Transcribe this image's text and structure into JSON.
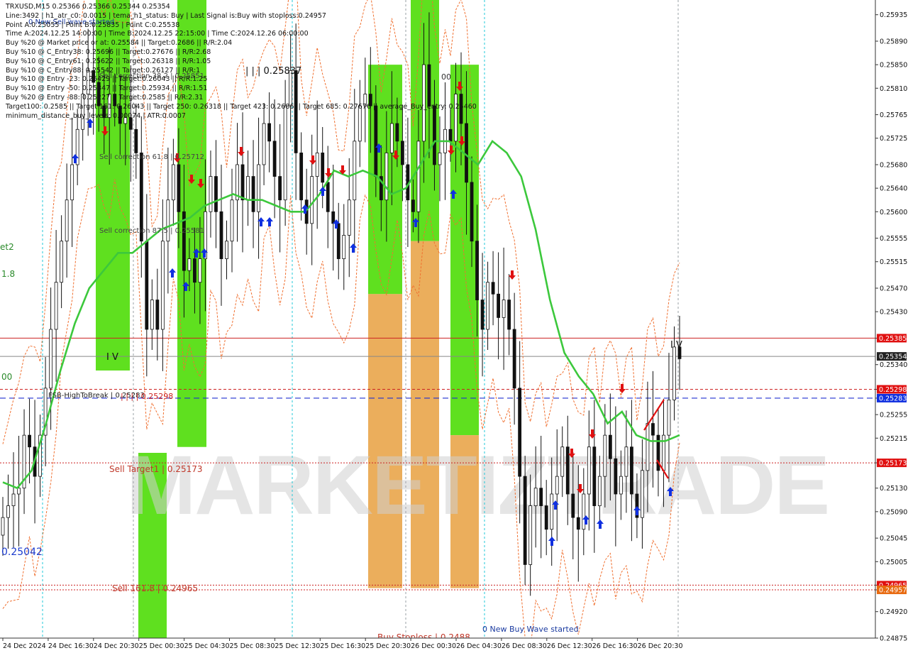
{
  "info_panel": [
    "TRXUSD,M15  0.25366 0.25366 0.25344 0.25354",
    "Line:3492 | h1_atr_c0: 0.0015 | tema_h1_status: Buy | Last Signal is:Buy with stoploss:0.24957",
    "Point A:0.25055 | Point B:0.25835 | Point C:0.25538",
    "Time A:2024.12.25 14:00:00 | Time B:2024.12.25 22:15:00 | Time C:2024.12.26 06:00:00",
    "Buy %20 @ Market price or at: 0.25584 || Target:0.2686 || R/R:2.04",
    "Buy %10 @ C_Entry38: 0.25696 || Target:0.27676 || R/R:2.68",
    "Buy %10 @ C_Entry61: 0.25622 || Target:0.26318 || R/R:1.05",
    "Buy %10 @ C_Entry88: 0.25542 || Target:0.26127 || R/R:1",
    "Buy %10 @ Entry -23: 0.25429 || Target:0.26043 || R/R:1.25",
    "Buy %10 @ Entry -50: 0.25347 || Target:0.25934 || R/R:1.51",
    "Buy %20 @ Entry -88: 0.25227 || Target:0.2585 || R/R:2.31",
    "Target100: 0.2585 || Target 161: 0.26043 || Target 250: 0.26318 || Target 423: 0.2686 || Target 685: 0.27676 || average_Buy_entry: 0.25460",
    "minimum_distance_buy_levels: 0.00074 | ATR:0.0007"
  ],
  "annotations": {
    "new_sell_wave": "0 New Sell wave started",
    "new_buy_wave": "0 New Buy Wave started",
    "peak_label": "| | | 0.25837",
    "low_label": "0.25042",
    "sell_corr_618": "Sell correction 61.8 | 0.25712",
    "sell_corr_875": "Sell correction 87.5 | 0.25581",
    "sell_corr_382": "Sell correction 38.2 | 0.25851",
    "fsb_label": "FSB-HighToBreak | 0.25283",
    "fsb_marks": "| | | | 0.25298",
    "sell_target1": "Sell Target1 | 0.25173",
    "sell_161": "Sell 161.8 | 0.24965",
    "buy_stoploss": "Buy Stoploss | 0.2488",
    "left_cut_1": "et2",
    "left_cut_2": "1.8",
    "left_cut_3": "00",
    "top_zero": "00",
    "iv_mark": "I V",
    "iv_mark2": "I V",
    "watermark": "MARKETIZTRADE"
  },
  "price_axis": [
    "0.25935",
    "0.25890",
    "0.25850",
    "0.25810",
    "0.25765",
    "0.25725",
    "0.25680",
    "0.25640",
    "0.25600",
    "0.25555",
    "0.25515",
    "0.25470",
    "0.25430",
    "0.25385",
    "0.25340",
    "0.25298",
    "0.25283",
    "0.25255",
    "0.25215",
    "0.25173",
    "0.25130",
    "0.25090",
    "0.25045",
    "0.25005",
    "0.24965",
    "0.24957",
    "0.24920",
    "0.24875"
  ],
  "price_badges": {
    "red_line": "0.25385",
    "current": "0.25354",
    "fsb_upper": "0.25298",
    "fsb_blue": "0.25283",
    "target1": "0.25173",
    "sell161": "0.24965",
    "stoploss": "0.24957"
  },
  "time_axis": [
    "24 Dec 2024",
    "24 Dec 16:30",
    "24 Dec 20:30",
    "25 Dec 00:30",
    "25 Dec 04:30",
    "25 Dec 08:30",
    "25 Dec 12:30",
    "25 Dec 16:30",
    "25 Dec 20:30",
    "26 Dec 00:30",
    "26 Dec 04:30",
    "26 Dec 08:30",
    "26 Dec 12:30",
    "26 Dec 16:30",
    "26 Dec 20:30"
  ],
  "chart_data": {
    "type": "candlestick",
    "symbol": "TRXUSD",
    "timeframe": "M15",
    "ylim": [
      0.24875,
      0.2596
    ],
    "last_price": 0.25354,
    "horizontal_levels": [
      {
        "value": 0.25385,
        "style": "solid-red"
      },
      {
        "value": 0.25354,
        "style": "solid-gray"
      },
      {
        "value": 0.25298,
        "style": "dashed-red"
      },
      {
        "value": 0.25283,
        "style": "dashed-blue"
      },
      {
        "value": 0.25173,
        "style": "dotted-red"
      },
      {
        "value": 0.24965,
        "style": "dotted-red"
      },
      {
        "value": 0.24957,
        "style": "dotted-red"
      }
    ],
    "close_path": [
      0.2508,
      0.251,
      0.2512,
      0.2513,
      0.2522,
      0.252,
      0.2515,
      0.2522,
      0.253,
      0.254,
      0.2548,
      0.2555,
      0.2562,
      0.2568,
      0.2574,
      0.258,
      0.2584,
      0.2582,
      0.2578,
      0.2576,
      0.258,
      0.2578,
      0.2575,
      0.2576,
      0.2574,
      0.257,
      0.2555,
      0.254,
      0.2545,
      0.254,
      0.2555,
      0.2562,
      0.2568,
      0.256,
      0.255,
      0.2552,
      0.2548,
      0.2552,
      0.256,
      0.2566,
      0.256,
      0.2552,
      0.2555,
      0.2562,
      0.2568,
      0.2562,
      0.2566,
      0.256,
      0.2568,
      0.2575,
      0.2572,
      0.2566,
      0.2562,
      0.2578,
      0.2584,
      0.257,
      0.2562,
      0.2558,
      0.2566,
      0.257,
      0.2565,
      0.256,
      0.2558,
      0.2552,
      0.2556,
      0.2562,
      0.2572,
      0.2578,
      0.258,
      0.2578,
      0.2566,
      0.2562,
      0.257,
      0.2575,
      0.2572,
      0.2568,
      0.2562,
      0.256,
      0.2572,
      0.2585,
      0.2578,
      0.2568,
      0.257,
      0.2574,
      0.2572,
      0.258,
      0.2575,
      0.2565,
      0.2555,
      0.2545,
      0.254,
      0.2548,
      0.2546,
      0.2542,
      0.2545,
      0.254,
      0.253,
      0.2515,
      0.25,
      0.251,
      0.2513,
      0.251,
      0.2506,
      0.2512,
      0.2515,
      0.252,
      0.2512,
      0.2508,
      0.2506,
      0.2512,
      0.252,
      0.251,
      0.2515,
      0.2522,
      0.2518,
      0.2512,
      0.2515,
      0.252,
      0.2512,
      0.2508,
      0.2516,
      0.2524,
      0.2522,
      0.2516,
      0.2522,
      0.2528,
      0.2537,
      0.2535
    ],
    "ma_series": [
      {
        "color": "#3cc83c",
        "values": [
          0.2514,
          0.2513,
          0.2516,
          0.2524,
          0.2533,
          0.2541,
          0.2547,
          0.255,
          0.2553,
          0.2553,
          0.2555,
          0.2557,
          0.2558,
          0.2559,
          0.2561,
          0.2562,
          0.2563,
          0.2562,
          0.2562,
          0.2561,
          0.256,
          0.256,
          0.2563,
          0.2567,
          0.2566,
          0.2567,
          0.2566,
          0.2563,
          0.2564,
          0.2568,
          0.2572,
          0.2572,
          0.257,
          0.2568,
          0.2572,
          0.257,
          0.2566,
          0.2557,
          0.2545,
          0.2536,
          0.2532,
          0.2529,
          0.2524,
          0.2526,
          0.2522,
          0.2521,
          0.2521,
          0.2522
        ]
      }
    ],
    "bands": [
      {
        "color": "#5fe01f",
        "from": 0.2533,
        "to": 0.2596
      },
      {
        "color": "#5fe01f",
        "from": 0.2484,
        "to": 0.2519
      },
      {
        "color": "#5fe01f",
        "from": 0.252,
        "to": 0.2596
      },
      {
        "color": "#5fe01f",
        "from": 0.2546,
        "to": 0.2585
      },
      {
        "color": "#e8a040",
        "from": 0.2496,
        "to": 0.2546
      },
      {
        "color": "#5fe01f",
        "from": 0.2555,
        "to": 0.2596
      },
      {
        "color": "#e8a040",
        "from": 0.2496,
        "to": 0.2555
      },
      {
        "color": "#5fe01f",
        "from": 0.2522,
        "to": 0.2585
      },
      {
        "color": "#e8a040",
        "from": 0.2496,
        "to": 0.2522
      }
    ]
  }
}
